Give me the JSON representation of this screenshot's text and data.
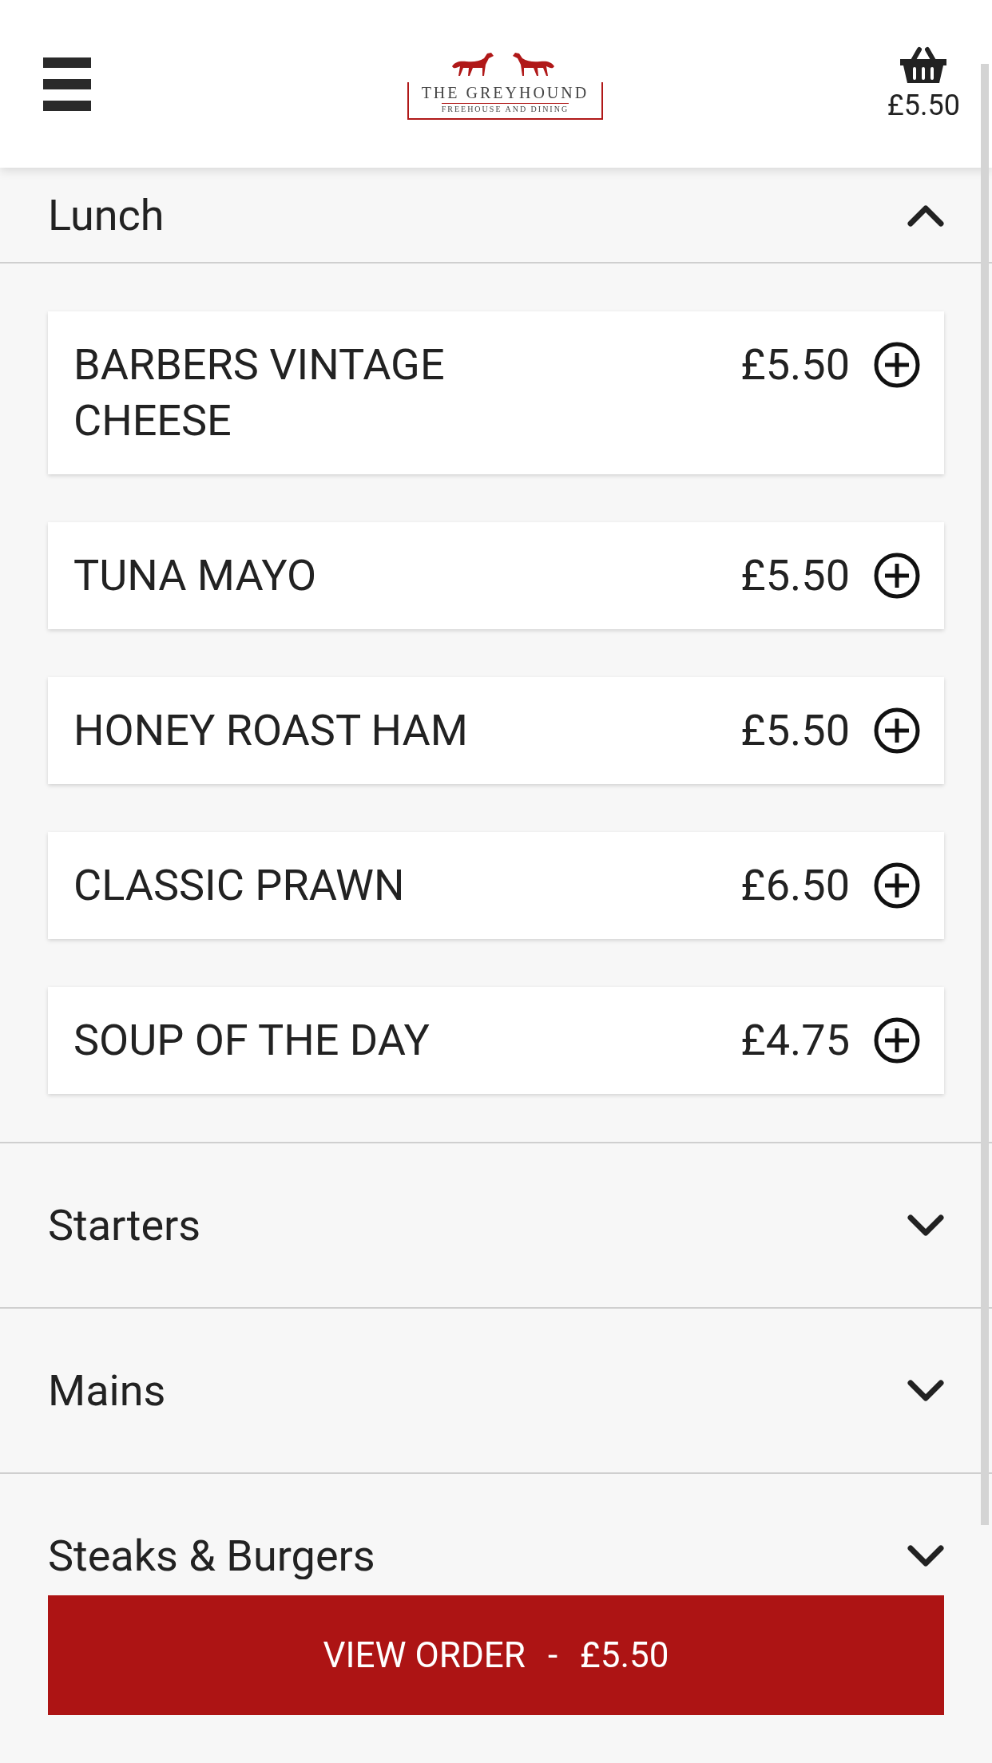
{
  "header": {
    "logo_title": "THE GREYHOUND",
    "logo_subtitle": "FREEHOUSE AND DINING",
    "basket_total": "£5.50"
  },
  "sections": [
    {
      "title": "Lunch",
      "expanded": true,
      "items": [
        {
          "name": "BARBERS VINTAGE CHEESE",
          "price": "£5.50"
        },
        {
          "name": "TUNA MAYO",
          "price": "£5.50"
        },
        {
          "name": "HONEY ROAST HAM",
          "price": "£5.50"
        },
        {
          "name": "CLASSIC PRAWN",
          "price": "£6.50"
        },
        {
          "name": "SOUP OF THE DAY",
          "price": "£4.75"
        }
      ]
    },
    {
      "title": "Starters",
      "expanded": false
    },
    {
      "title": "Mains",
      "expanded": false
    },
    {
      "title": "Steaks & Burgers",
      "expanded": false
    }
  ],
  "order_button": {
    "label": "VIEW ORDER",
    "separator": "-",
    "total": "£5.50"
  }
}
